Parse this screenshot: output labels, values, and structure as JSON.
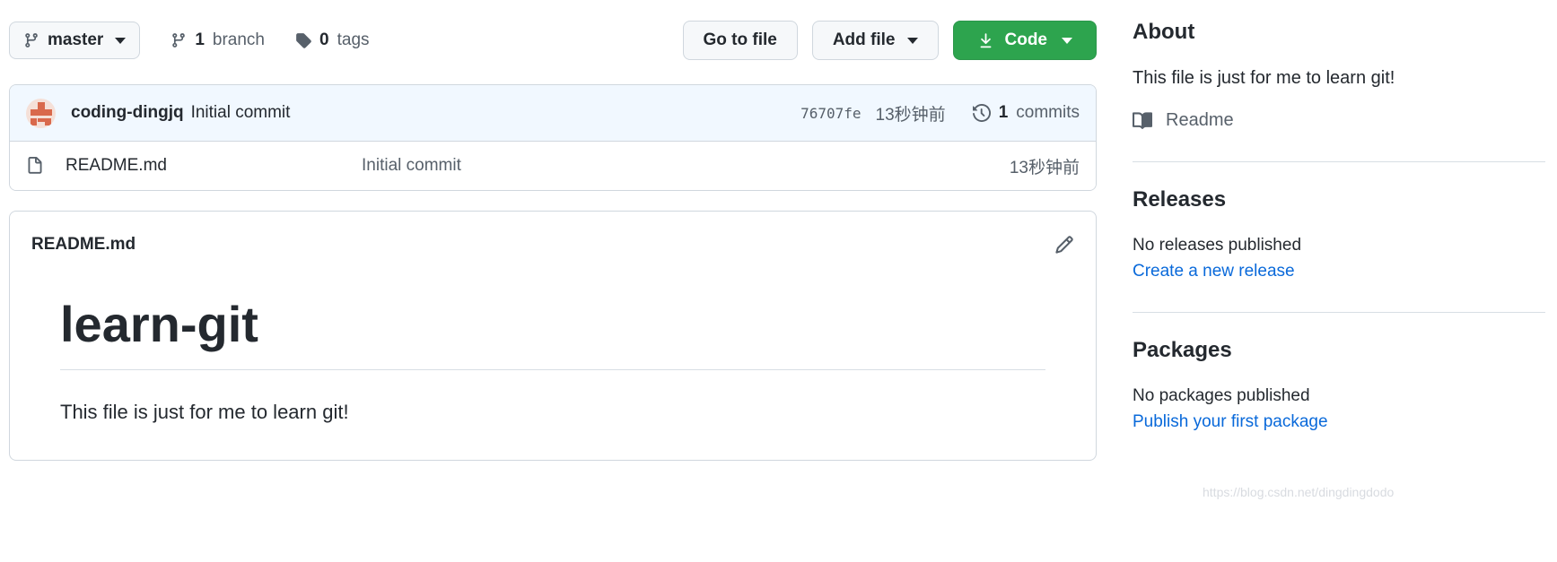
{
  "toolbar": {
    "branch_selector": {
      "label": "master",
      "icon": "branch-icon"
    },
    "branch_count": {
      "value": "1",
      "label": "branch",
      "icon": "branch-icon"
    },
    "tag_count": {
      "value": "0",
      "label": "tags",
      "icon": "tag-icon"
    },
    "go_to_file": "Go to file",
    "add_file": "Add file",
    "code": "Code"
  },
  "commit": {
    "author": "coding-dingjq",
    "message": "Initial commit",
    "sha": "76707fe",
    "time": "13秒钟前",
    "commits_count": "1",
    "commits_label": "commits",
    "history_icon": "history-clock-icon",
    "avatar": "user-avatar"
  },
  "files": [
    {
      "icon": "file-icon",
      "name": "README.md",
      "message": "Initial commit",
      "time": "13秒钟前"
    }
  ],
  "readme": {
    "filename": "README.md",
    "edit_icon": "pencil-icon",
    "heading": "learn-git",
    "paragraph": "This file is just for me to learn git!"
  },
  "sidebar": {
    "about": {
      "title": "About",
      "description": "This file is just for me to learn git!",
      "readme_link": "Readme",
      "readme_icon": "book-icon"
    },
    "releases": {
      "title": "Releases",
      "empty_note": "No releases published",
      "action_link": "Create a new release"
    },
    "packages": {
      "title": "Packages",
      "empty_note": "No packages published",
      "action_link": "Publish your first package"
    }
  },
  "watermark": "https://blog.csdn.net/dingdingdodo",
  "colors": {
    "accent_green": "#2da44e",
    "link_blue": "#0969da",
    "commit_row_bg": "#f1f8ff",
    "border": "#d0d7de",
    "muted_text": "#57606a"
  }
}
